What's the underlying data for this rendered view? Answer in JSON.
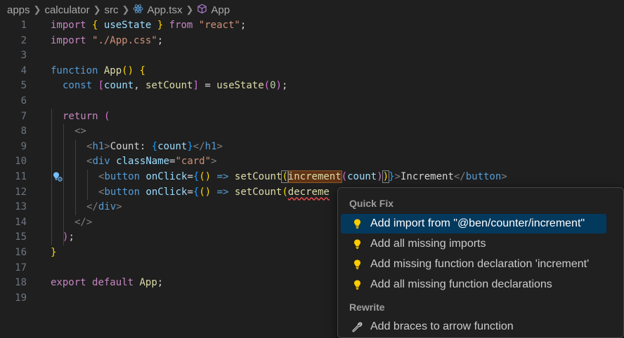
{
  "breadcrumb": {
    "items": [
      "apps",
      "calculator",
      "src",
      "App.tsx",
      "App"
    ],
    "icons": [
      "react-icon",
      "component-icon"
    ]
  },
  "editor": {
    "line_numbers": [
      "1",
      "2",
      "3",
      "4",
      "5",
      "6",
      "7",
      "8",
      "9",
      "10",
      "11",
      "12",
      "13",
      "14",
      "15",
      "16",
      "17",
      "18",
      "19"
    ],
    "lines": {
      "l1": {
        "t1": "import",
        "t2": "{",
        "t3": "useState",
        "t4": "}",
        "t5": "from",
        "t6": "\"react\"",
        "t7": ";"
      },
      "l2": {
        "t1": "import",
        "t2": "\"./App.css\"",
        "t3": ";"
      },
      "l4": {
        "t1": "function",
        "t2": "App",
        "t3": "()",
        "t4": "{"
      },
      "l5": {
        "t1": "const",
        "t2": "[",
        "t3": "count",
        "t4": ", ",
        "t5": "setCount",
        "t6": "]",
        "t7": " = ",
        "t8": "useState",
        "t9": "(",
        "t10": "0",
        "t11": ")",
        "t12": ";"
      },
      "l7": {
        "t1": "return",
        "t2": "("
      },
      "l8": {
        "t1": "<>"
      },
      "l9": {
        "t1": "<",
        "t2": "h1",
        "t3": ">",
        "t4": "Count: ",
        "t5": "{",
        "t6": "count",
        "t7": "}",
        "t8": "</",
        "t9": "h1",
        "t10": ">"
      },
      "l10": {
        "t1": "<",
        "t2": "div",
        "t3": "className",
        "t4": "=",
        "t5": "\"card\"",
        "t6": ">"
      },
      "l11": {
        "t1": "<",
        "t2": "button",
        "t3": "onClick",
        "t4": "=",
        "t5": "{",
        "t6": "()",
        "t7": " => ",
        "t8": "setCount",
        "t9": "(",
        "t10": "increment",
        "t11": "(",
        "t12": "count",
        "t13": ")",
        "t14": ")",
        "t15": "}",
        "t16": ">",
        "t17": "Increment",
        "t18": "</",
        "t19": "button",
        "t20": ">"
      },
      "l12": {
        "t1": "<",
        "t2": "button",
        "t3": "onClick",
        "t4": "=",
        "t5": "{",
        "t6": "()",
        "t7": " => ",
        "t8": "setCount",
        "t9": "(",
        "t10": "decreme"
      },
      "l13": {
        "t1": "</",
        "t2": "div",
        "t3": ">"
      },
      "l14": {
        "t1": "</>"
      },
      "l15": {
        "t1": ")",
        "t2": ";"
      },
      "l16": {
        "t1": "}"
      },
      "l18": {
        "t1": "export",
        "t2": "default",
        "t3": "App",
        "t4": ";"
      }
    }
  },
  "quick_fix_menu": {
    "section1": "Quick Fix",
    "items": [
      {
        "label": "Add import from \"@ben/counter/increment\"",
        "icon": "lightbulb-icon",
        "selected": true
      },
      {
        "label": "Add all missing imports",
        "icon": "lightbulb-icon",
        "selected": false
      },
      {
        "label": "Add missing function declaration 'increment'",
        "icon": "lightbulb-icon",
        "selected": false
      },
      {
        "label": "Add all missing function declarations",
        "icon": "lightbulb-icon",
        "selected": false
      }
    ],
    "section2": "Rewrite",
    "rewrite_items": [
      {
        "label": "Add braces to arrow function",
        "icon": "wrench-icon"
      }
    ]
  },
  "colors": {
    "background": "#1f1f1f",
    "keyword": "#569cd6",
    "control_keyword": "#c586c0",
    "function": "#dcdcaa",
    "string": "#ce9178",
    "variable": "#9cdcfe",
    "selected_item": "#04395e",
    "lightbulb": "#ffcc00"
  }
}
